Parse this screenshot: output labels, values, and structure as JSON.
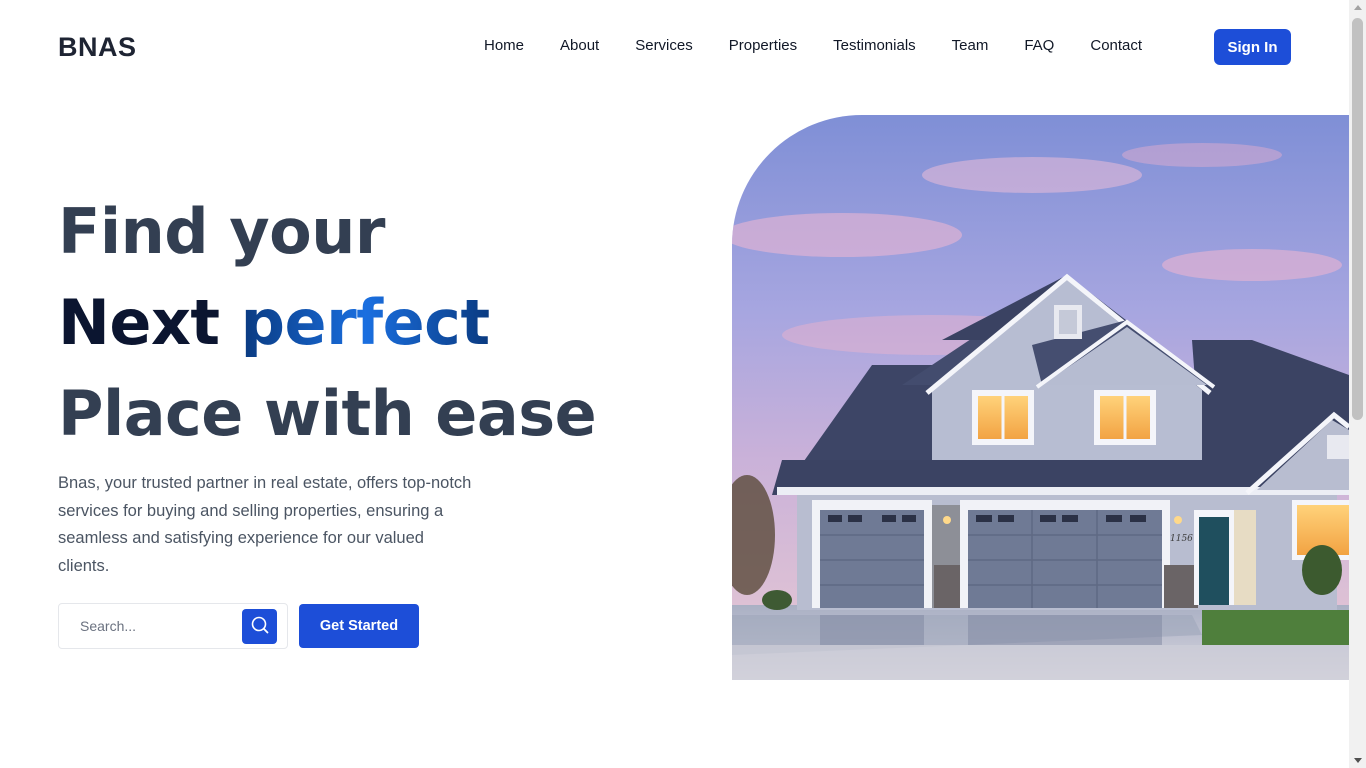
{
  "brand": {
    "logo_text": "BNAS"
  },
  "nav": {
    "items": [
      {
        "label": "Home"
      },
      {
        "label": "About"
      },
      {
        "label": "Services"
      },
      {
        "label": "Properties"
      },
      {
        "label": "Testimonials"
      },
      {
        "label": "Team"
      },
      {
        "label": "FAQ"
      },
      {
        "label": "Contact"
      }
    ],
    "signin_label": "Sign In"
  },
  "hero": {
    "line1": "Find your",
    "line2_prefix": "Next ",
    "line2_accent": "perfect",
    "line3": "Place with ease",
    "description": "Bnas, your trusted partner in real estate, offers top-notch services for buying and selling properties, ensuring a seamless and satisfying experience for our valued clients.",
    "search_placeholder": "Search...",
    "search_icon": "search-icon",
    "cta_label": "Get Started",
    "image_subject": "house-photo",
    "house_number": "1156"
  },
  "colors": {
    "primary": "#1d4ed8",
    "heading": "#333f52",
    "heading_dark": "#0b1530",
    "accent_gradient_start": "#0a3a80",
    "accent_gradient_mid": "#1a6fe0",
    "body_text": "#4b5563"
  }
}
